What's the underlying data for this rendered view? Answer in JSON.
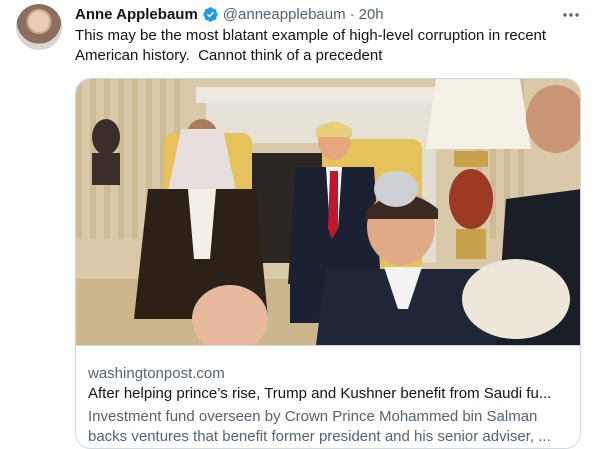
{
  "author": {
    "name": "Anne Applebaum",
    "handle": "@anneapplebaum",
    "separator": "·",
    "time": "20h",
    "verified_icon": "verified-badge-icon",
    "verified_color": "#1d9bf0"
  },
  "tweet": {
    "text_lines": [
      "This may be the most blatant example of high-level corruption in recent",
      "American history.  Cannot think of a precedent"
    ]
  },
  "more_icon": "more-horizontal-icon",
  "card": {
    "image_icon": "photo-oval-office-meeting",
    "domain": "washingtonpost.com",
    "title": "After helping prince’s rise, Trump and Kushner benefit from Saudi fu...",
    "description_lines": [
      "Investment fund overseen by Crown Prince Mohammed bin Salman",
      "backs ventures that benefit former president and his senior adviser, ..."
    ]
  },
  "colors": {
    "text": "#0f1419",
    "secondary": "#536471",
    "border": "#cfd9de",
    "accent": "#1d9bf0"
  }
}
